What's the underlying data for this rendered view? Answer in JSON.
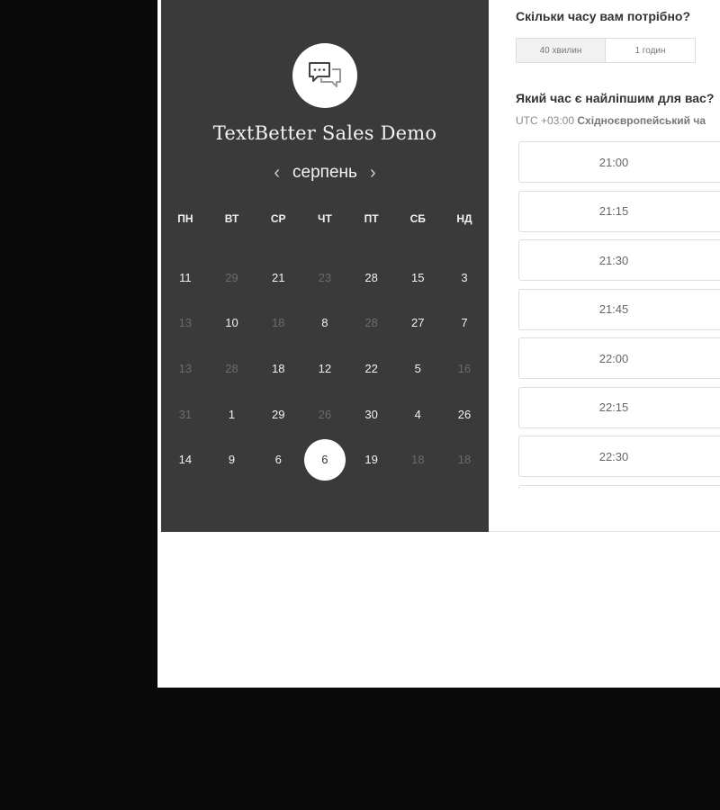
{
  "brand": {
    "title": "TextBetter Sales Demo",
    "logo_icon": "chat-bubbles-icon"
  },
  "calendar": {
    "month": "серпень",
    "prev_icon": "chevron-left-icon",
    "next_icon": "chevron-right-icon",
    "weekdays": [
      "ПН",
      "ВТ",
      "СР",
      "ЧТ",
      "ПТ",
      "СБ",
      "НД"
    ],
    "weeks": [
      [
        {
          "d": "11",
          "dim": false
        },
        {
          "d": "29",
          "dim": true
        },
        {
          "d": "21",
          "dim": false
        },
        {
          "d": "23",
          "dim": true
        },
        {
          "d": "28",
          "dim": false
        },
        {
          "d": "15",
          "dim": false
        },
        {
          "d": "3",
          "dim": false
        }
      ],
      [
        {
          "d": "13",
          "dim": true
        },
        {
          "d": "10",
          "dim": false
        },
        {
          "d": "18",
          "dim": true
        },
        {
          "d": "8",
          "dim": false
        },
        {
          "d": "28",
          "dim": true
        },
        {
          "d": "27",
          "dim": false
        },
        {
          "d": "7",
          "dim": false
        }
      ],
      [
        {
          "d": "13",
          "dim": true
        },
        {
          "d": "28",
          "dim": true
        },
        {
          "d": "18",
          "dim": false
        },
        {
          "d": "12",
          "dim": false
        },
        {
          "d": "22",
          "dim": false
        },
        {
          "d": "5",
          "dim": false
        },
        {
          "d": "16",
          "dim": true
        }
      ],
      [
        {
          "d": "31",
          "dim": true
        },
        {
          "d": "1",
          "dim": false
        },
        {
          "d": "29",
          "dim": false
        },
        {
          "d": "26",
          "dim": true
        },
        {
          "d": "30",
          "dim": false
        },
        {
          "d": "4",
          "dim": false
        },
        {
          "d": "26",
          "dim": false
        }
      ],
      [
        {
          "d": "14",
          "dim": false
        },
        {
          "d": "9",
          "dim": false
        },
        {
          "d": "6",
          "dim": false
        },
        {
          "d": "6",
          "dim": false,
          "selected": true
        },
        {
          "d": "19",
          "dim": false
        },
        {
          "d": "18",
          "dim": true
        },
        {
          "d": "18",
          "dim": true
        }
      ]
    ]
  },
  "booking": {
    "duration_question": "Скільки часу вам потрібно?",
    "durations": [
      {
        "label": "40 хвилин",
        "active": true
      },
      {
        "label": "1 годин",
        "active": false
      }
    ],
    "time_question": "Який час є найліпшим для вас?",
    "timezone_offset": "UTC +03:00",
    "timezone_name": "Східноєвропейський ча",
    "slots": [
      "21:00",
      "21:15",
      "21:30",
      "21:45",
      "22:00",
      "22:15",
      "22:30",
      ""
    ]
  },
  "colors": {
    "page_background": "#0a0a0a",
    "calendar_panel": "#3a3a3a",
    "content_panel": "#ffffff"
  }
}
